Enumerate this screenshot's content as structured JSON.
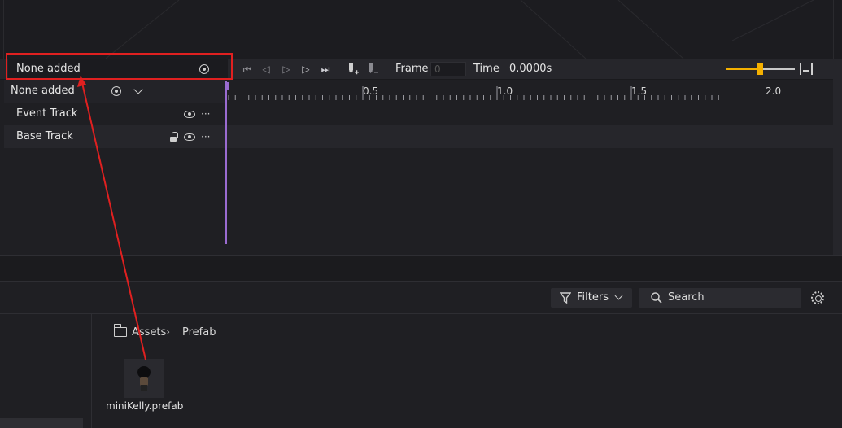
{
  "animation_editor": {
    "clip_select_value": "None added",
    "toolbar": {
      "frame_label": "Frame",
      "frame_value": "0",
      "time_label": "Time",
      "time_value": "0.0000s",
      "zoom_level": 0.5
    },
    "node_row_label": "None added",
    "tracks": [
      {
        "label": "Event Track"
      },
      {
        "label": "Base Track"
      }
    ],
    "ruler_ticks": [
      "0.5",
      "1.0",
      "1.5",
      "2.0"
    ]
  },
  "assets_panel": {
    "filters_label": "Filters",
    "search_placeholder": "Search",
    "breadcrumb": [
      "Assets",
      "Prefab"
    ],
    "items": [
      {
        "name": "miniKelly.prefab"
      }
    ]
  },
  "colors": {
    "highlight_box": "#e02020",
    "arrow": "#e02020",
    "slider_accent": "#f4b000",
    "playhead": "#9a6bd0"
  }
}
